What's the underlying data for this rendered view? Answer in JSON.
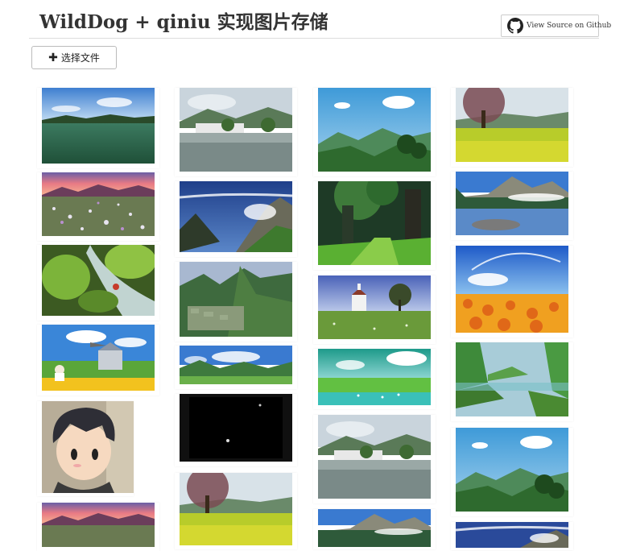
{
  "header": {
    "title": "WildDog + qiniu 实现图片存储",
    "github_button_label": "View Source on Github",
    "github_icon": "github-octocat-icon"
  },
  "toolbar": {
    "upload_button_label": "选择文件",
    "upload_icon": "plus-icon"
  },
  "gallery": {
    "images": [
      {
        "id": "c1-lake-reflection",
        "description": "lake with blue sky and distant hills"
      },
      {
        "id": "c1-sunset-wildflowers",
        "description": "sunset over mountains with wildflower field"
      },
      {
        "id": "c1-mossy-waterfall",
        "description": "mossy rocks with waterfall stream"
      },
      {
        "id": "c1-fantasy-meadow",
        "description": "girl in meadow with castle and airplane"
      },
      {
        "id": "c1-cartoon-boy",
        "description": "cartoon boy with dark hair"
      },
      {
        "id": "c1-sunset-wildflowers-2",
        "description": "sunset over mountains with wildflower field"
      },
      {
        "id": "c2-village-lake",
        "description": "village houses by a reflective lake"
      },
      {
        "id": "c2-mountain-valley",
        "description": "mountain valley with dramatic clouds"
      },
      {
        "id": "c2-machu-picchu",
        "description": "ancient ruins on green mountain"
      },
      {
        "id": "c2-panorama-hills",
        "description": "wide panorama of green hills"
      },
      {
        "id": "c2-black-screen",
        "description": "mostly black image"
      },
      {
        "id": "c2-blossom-rapefield",
        "description": "blossom tree over yellow rapeseed field"
      },
      {
        "id": "c3-green-mountains",
        "description": "blue sky over green mountains"
      },
      {
        "id": "c3-forest-path",
        "description": "green forest with large trees"
      },
      {
        "id": "c3-chapel-meadow",
        "description": "small white chapel in meadow"
      },
      {
        "id": "c3-lagoon-meadow",
        "description": "turquoise lagoon with green meadow"
      },
      {
        "id": "c3-village-lake",
        "description": "village houses by a reflective lake"
      },
      {
        "id": "c3-alpine-lake",
        "description": "mountain lake with reflection"
      },
      {
        "id": "c4-blossom-rapefield",
        "description": "blossom tree over yellow rapeseed field"
      },
      {
        "id": "c4-alpine-lake",
        "description": "mountain lake with pine forest"
      },
      {
        "id": "c4-sunflower-field",
        "description": "sunflower field under blue sky"
      },
      {
        "id": "c4-bamboo-river",
        "description": "river with bamboo and green banks"
      },
      {
        "id": "c4-green-mountains",
        "description": "blue sky over green mountains"
      },
      {
        "id": "c4-mountain-valley",
        "description": "mountain valley with dramatic clouds"
      }
    ]
  }
}
